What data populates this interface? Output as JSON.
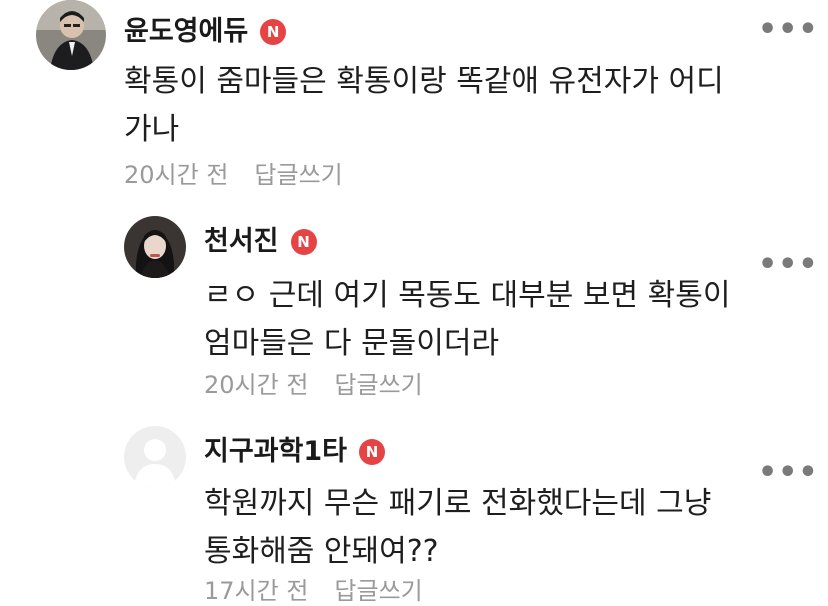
{
  "comments": [
    {
      "author": "윤도영에듀",
      "badge": "N",
      "text": "확통이 줌마들은 확통이랑 똑같애 유전자가 어디\n가나",
      "time": "20시간 전",
      "reply": "답글쓰기",
      "more": "•••"
    },
    {
      "author": "천서진",
      "badge": "N",
      "text": "ㄹㅇ 근데 여기 목동도 대부분 보면 확통이\n엄마들은 다 문돌이더라",
      "time": "20시간 전",
      "reply": "답글쓰기",
      "more": "•••"
    },
    {
      "author": "지구과학1타",
      "badge": "N",
      "text": "학원까지 무슨 패기로 전화했다는데 그냥\n통화해줌 안돼여??",
      "time": "17시간 전",
      "reply": "답글쓰기",
      "more": "•••"
    }
  ],
  "colors": {
    "badge": "#e64444",
    "meta": "#9a9a9a",
    "text": "#1e1e1e"
  }
}
